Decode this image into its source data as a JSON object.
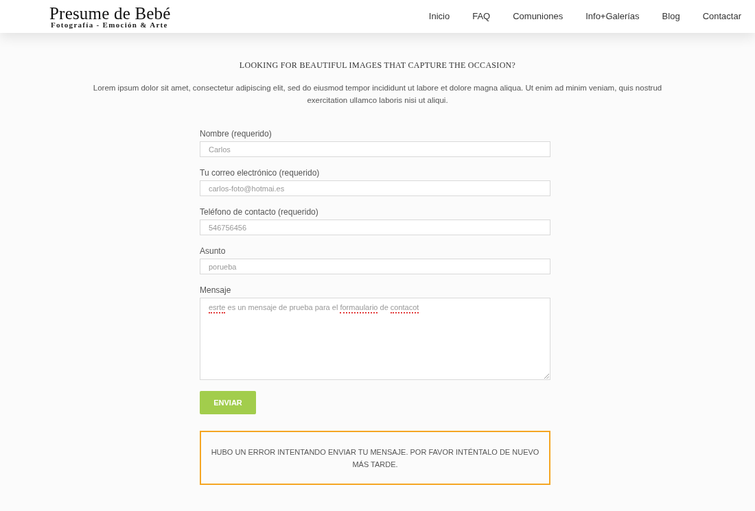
{
  "header": {
    "logo": {
      "title": "Presume de Bebé",
      "tagline": "Fotografía - Emoción & Arte"
    },
    "nav": [
      {
        "label": "Inicio"
      },
      {
        "label": "FAQ"
      },
      {
        "label": "Comuniones"
      },
      {
        "label": "Info+Galerías"
      },
      {
        "label": "Blog"
      },
      {
        "label": "Contactar"
      }
    ]
  },
  "intro": {
    "heading": "LOOKING FOR BEAUTIFUL IMAGES THAT CAPTURE THE OCCASION?",
    "text": "Lorem ipsum dolor sit amet, consectetur adipiscing elit, sed do eiusmod tempor incididunt ut labore et dolore magna aliqua. Ut enim ad minim veniam, quis nostrud exercitation ullamco laboris nisi ut aliqui."
  },
  "form": {
    "fields": [
      {
        "kind": "input",
        "label": "Nombre (requerido)",
        "value": "Carlos"
      },
      {
        "kind": "input",
        "label": "Tu correo electrónico (requerido)",
        "value": "carlos-foto@hotmai.es"
      },
      {
        "kind": "input",
        "label": "Teléfono de contacto (requerido)",
        "value": "546756456"
      },
      {
        "kind": "input",
        "label": "Asunto",
        "value": "porueba"
      },
      {
        "kind": "textarea",
        "label": "Mensaje",
        "segments": [
          {
            "text": "esrte",
            "misspelled": true
          },
          {
            "text": " es un mensaje de prueba para el ",
            "misspelled": false
          },
          {
            "text": "formaulario",
            "misspelled": true
          },
          {
            "text": " de ",
            "misspelled": false
          },
          {
            "text": "contacot",
            "misspelled": true
          }
        ]
      }
    ],
    "submit": "ENVIAR"
  },
  "alert": {
    "kind": "error",
    "message": "HUBO UN ERROR INTENTANDO ENVIAR TU MENSAJE. POR FAVOR INTÉNTALO DE NUEVO MÁS TARDE."
  }
}
